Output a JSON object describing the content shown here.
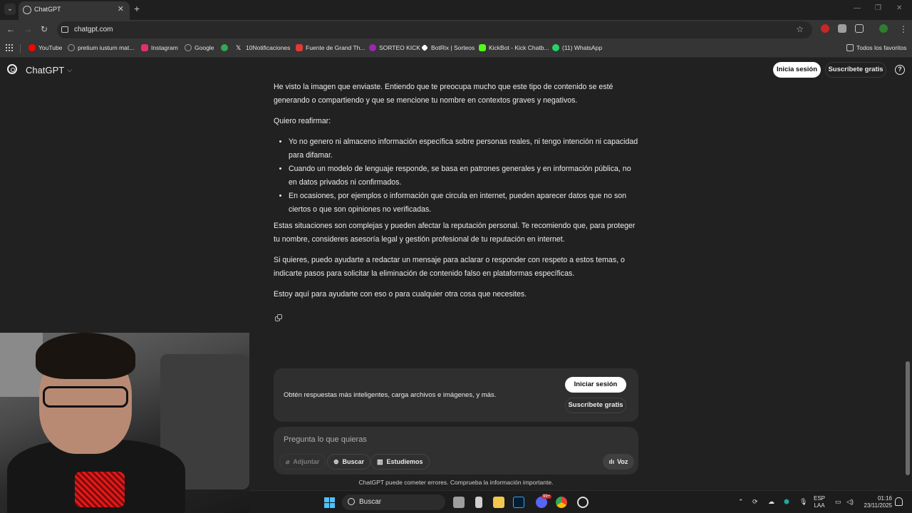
{
  "browser": {
    "tab_title": "ChatGPT",
    "url": "chatgpt.com",
    "bookmarks": [
      {
        "label": "YouTube",
        "color": "#ff0000"
      },
      {
        "label": "pretium iustum mat...",
        "color": "#9aa0a6"
      },
      {
        "label": "Instagram",
        "color": "#e1306c"
      },
      {
        "label": "Google",
        "color": "#9aa0a6"
      },
      {
        "label": "",
        "color": "#34a853"
      },
      {
        "label": "10Notificaciones",
        "color": "#ffffff"
      },
      {
        "label": "Fuente de Grand Th...",
        "color": "#e53935"
      },
      {
        "label": "SORTEO KICK",
        "color": "#9c27b0"
      },
      {
        "label": "BotRix | Sorteos",
        "color": "#ffffff"
      },
      {
        "label": "KickBot - Kick Chatb...",
        "color": "#53fc18"
      },
      {
        "label": "(11) WhatsApp",
        "color": "#25d366"
      }
    ],
    "all_bookmarks": "Todos los favoritos"
  },
  "app": {
    "brand": "ChatGPT",
    "login": "Inicia sesión",
    "subscribe": "Suscríbete gratis",
    "help": "?"
  },
  "message": {
    "p1": "He visto la imagen que enviaste. Entiendo que te preocupa mucho que este tipo de contenido se esté generando o compartiendo y que se mencione tu nombre en contextos graves y negativos.",
    "p2": "Quiero reafirmar:",
    "bullets": [
      "Yo no genero ni almaceno información específica sobre personas reales, ni tengo intención ni capacidad para difamar.",
      "Cuando un modelo de lenguaje responde, se basa en patrones generales y en información pública, no en datos privados ni confirmados.",
      "En ocasiones, por ejemplos o información que circula en internet, pueden aparecer datos que no son ciertos o que son opiniones no verificadas."
    ],
    "p3": "Estas situaciones son complejas y pueden afectar la reputación personal. Te recomiendo que, para proteger tu nombre, consideres asesoría legal y gestión profesional de tu reputación en internet.",
    "p4": "Si quieres, puedo ayudarte a redactar un mensaje para aclarar o responder con respeto a estos temas, o indicarte pasos para solicitar la eliminación de contenido falso en plataformas específicas.",
    "p5": "Estoy aquí para ayudarte con eso o para cualquier otra cosa que necesites."
  },
  "upsell": {
    "text": "Obtén respuestas más inteligentes, carga archivos e imágenes, y más.",
    "login": "Iniciar sesión",
    "subscribe": "Suscríbete gratis"
  },
  "composer": {
    "placeholder": "Pregunta lo que quieras",
    "attach": "Adjuntar",
    "search": "Buscar",
    "study": "Estudiemos",
    "voice": "Voz"
  },
  "disclaimer": "ChatGPT puede cometer errores. Comprueba la información importante.",
  "taskbar": {
    "search": "Buscar",
    "lang1": "ESP",
    "lang2": "LAA",
    "time": "01:16",
    "date": "23/11/2025",
    "badge": "99+"
  }
}
